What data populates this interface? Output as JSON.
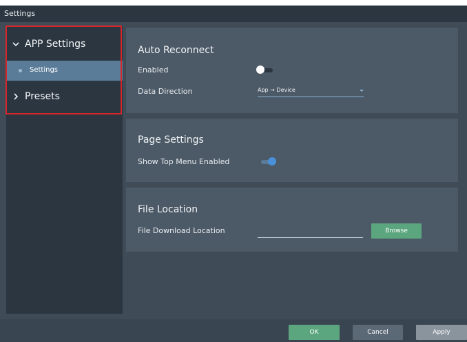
{
  "window": {
    "title": "Settings"
  },
  "sidebar": {
    "groups": [
      {
        "label": "APP Settings",
        "expanded": true,
        "icon": "chevron-down-icon"
      },
      {
        "label": "Presets",
        "expanded": false,
        "icon": "chevron-right-icon"
      }
    ],
    "items": [
      {
        "label": "Settings",
        "selected": true
      }
    ]
  },
  "panels": {
    "auto_reconnect": {
      "title": "Auto Reconnect",
      "enabled_label": "Enabled",
      "enabled": false,
      "direction_label": "Data Direction",
      "direction_value": "App → Device"
    },
    "page_settings": {
      "title": "Page Settings",
      "top_menu_label": "Show Top Menu Enabled",
      "top_menu_enabled": true
    },
    "file_location": {
      "title": "File Location",
      "download_label": "File Download Location",
      "download_value": "",
      "browse_label": "Browse"
    }
  },
  "footer": {
    "ok": "OK",
    "cancel": "Cancel",
    "apply": "Apply"
  },
  "colors": {
    "accent": "#5ba67f",
    "selected": "#5a7c99",
    "toggle_on": "#4a90d9",
    "highlight_box": "#d6262a"
  }
}
